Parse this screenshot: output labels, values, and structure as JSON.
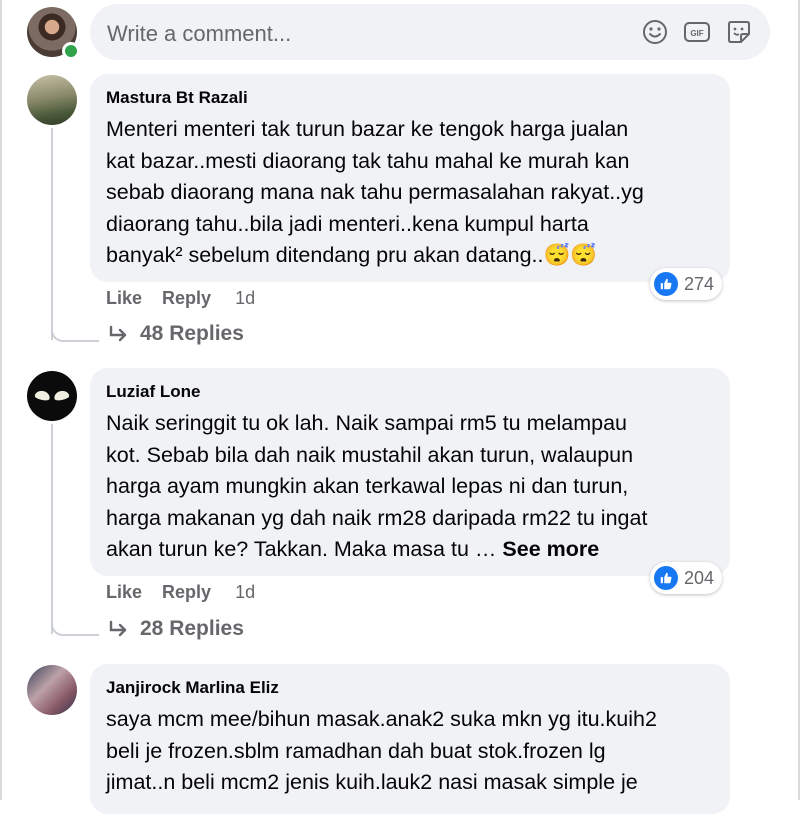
{
  "composer": {
    "placeholder": "Write a comment...",
    "icons": [
      "emoji-icon",
      "gif-icon",
      "sticker-icon"
    ]
  },
  "comments": [
    {
      "author": "Mastura Bt Razali",
      "text": "Menteri menteri tak turun bazar ke tengok harga jualan\nkat bazar..mesti diaorang tak tahu mahal ke murah kan\nsebab diaorang mana nak tahu permasalahan rakyat..yg\ndiaorang tahu..bila jadi menteri..kena kumpul harta\nbanyak² sebelum ditendang pru akan datang..😴😴",
      "reaction_count": "274",
      "like_label": "Like",
      "reply_label": "Reply",
      "time": "1d",
      "replies_label": "48 Replies"
    },
    {
      "author": "Luziaf Lone",
      "text": "Naik seringgit tu ok lah. Naik sampai rm5 tu melampau\nkot. Sebab bila dah naik mustahil akan turun, walaupun\nharga ayam mungkin akan terkawal lepas ni dan turun,\nharga makanan yg dah naik rm28 daripada rm22 tu ingat\nakan turun ke? Takkan. Maka masa tu …",
      "see_more": "See more",
      "reaction_count": "204",
      "like_label": "Like",
      "reply_label": "Reply",
      "time": "1d",
      "replies_label": "28 Replies"
    },
    {
      "author": "Janjirock Marlina Eliz",
      "text": "saya mcm mee/bihun masak.anak2 suka mkn yg itu.kuih2\nbeli je frozen.sblm ramadhan dah buat stok.frozen lg\njimat..n beli mcm2 jenis kuih.lauk2 nasi masak simple je"
    }
  ],
  "colors": {
    "like_blue": "#1877f2",
    "bubble_bg": "#f0f2f5",
    "secondary_text": "#65676b",
    "online_green": "#31a24c"
  }
}
